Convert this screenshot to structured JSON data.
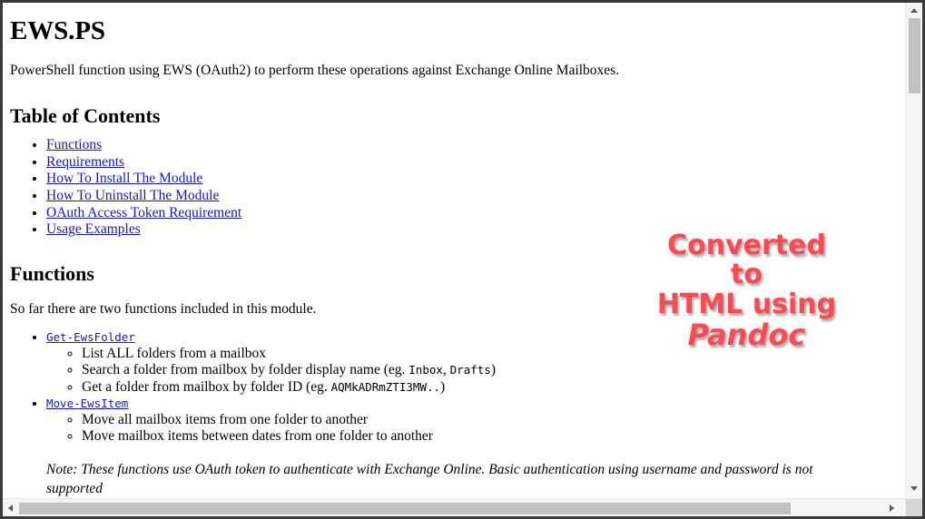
{
  "document": {
    "title": "EWS.PS",
    "intro": "PowerShell function using EWS (OAuth2) to perform these operations against Exchange Online Mailboxes.",
    "toc_heading": "Table of Contents",
    "toc_items": [
      {
        "label": "Functions"
      },
      {
        "label": "Requirements"
      },
      {
        "label": "How To Install The Module"
      },
      {
        "label": "How To Uninstall The Module"
      },
      {
        "label": "OAuth Access Token Requirement"
      },
      {
        "label": "Usage Examples"
      }
    ],
    "functions_heading": "Functions",
    "functions_lead": "So far there are two functions included in this module.",
    "functions": [
      {
        "name": "Get-EwsFolder",
        "bullets": [
          {
            "text": "List ALL folders from a mailbox"
          },
          {
            "text_before": "Search a folder from mailbox by folder display name (eg. ",
            "code": "Inbox",
            "text_mid": ", ",
            "code2": "Drafts",
            "text_after": ")"
          },
          {
            "text_before": "Get a folder from mailbox by folder ID (eg. ",
            "code": "AQMkADRmZTI3MW..",
            "text_after": ")"
          }
        ]
      },
      {
        "name": "Move-EwsItem",
        "bullets": [
          {
            "text": "Move all mailbox items from one folder to another"
          },
          {
            "text": "Move mailbox items between dates from one folder to another"
          }
        ]
      }
    ],
    "note": "Note: These functions use OAuth token to authenticate with Exchange Online. Basic authentication using username and password is not supported"
  },
  "watermark": {
    "line1": "Converted to",
    "line2": "HTML using",
    "line3": "Pandoc",
    "color": "#fa4a52",
    "outline_color": "#ffffff"
  },
  "scrollbars": {
    "vertical": {
      "up_arrow": "▲",
      "down_arrow": "▼",
      "thumb_color": "#c1c1c1",
      "track_color": "#f5f5f5"
    },
    "horizontal": {
      "left_arrow": "◀",
      "right_arrow": "▶",
      "thumb_color": "#c1c1c1",
      "track_color": "#f5f5f5"
    }
  },
  "theme": {
    "link_color": "#1a15c8",
    "text_color": "#000000",
    "page_background": "#ffffff",
    "window_border": "#3a3a3a"
  }
}
